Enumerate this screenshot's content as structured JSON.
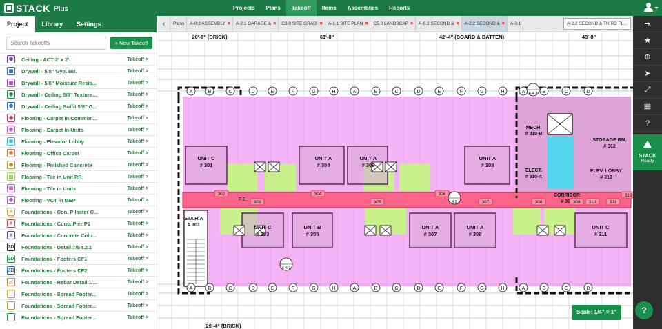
{
  "brand": {
    "name": "STACK",
    "edition": "Plus"
  },
  "nav": [
    "Projects",
    "Plans",
    "Takeoff",
    "Items",
    "Assemblies",
    "Reports"
  ],
  "nav_active": "Takeoff",
  "sidebar": {
    "tabs": [
      "Project",
      "Library",
      "Settings"
    ],
    "active_tab": "Project",
    "search_placeholder": "Search Takeoffs",
    "new_button": "+ New Takeoff",
    "link_label": "Takeoff >",
    "items": [
      {
        "label": "Ceiling - ACT 2' x 2'",
        "icon": "pentagon-icon",
        "glyph": "⬟",
        "color": "#7b3fb6"
      },
      {
        "label": "Drywall - 5/8\" Gyp. Bd.",
        "icon": "grid-icon",
        "glyph": "▦",
        "color": "#2f6bd6"
      },
      {
        "label": "Drywall - 5/8\" Moisture Resis...",
        "icon": "grid-icon",
        "glyph": "▦",
        "color": "#c23fd6"
      },
      {
        "label": "Drywall - Ceiling 5/8\" Texture...",
        "icon": "pentagon-icon",
        "glyph": "⬟",
        "color": "#1f9a4a"
      },
      {
        "label": "Drywall - Ceiling Soffit 5/8\" G...",
        "icon": "pentagon-icon",
        "glyph": "⬟",
        "color": "#2f6bd6"
      },
      {
        "label": "Flooring - Carpet in Common...",
        "icon": "pentagon-icon",
        "glyph": "⬟",
        "color": "#e0335d"
      },
      {
        "label": "Flooring - Carpet in Units",
        "icon": "pentagon-icon",
        "glyph": "⬟",
        "color": "#d64fd1"
      },
      {
        "label": "Flooring - Elevator Lobby",
        "icon": "pentagon-icon",
        "glyph": "⬟",
        "color": "#2fc2e0"
      },
      {
        "label": "Flooring - Office Carpet",
        "icon": "pentagon-icon",
        "glyph": "⬟",
        "color": "#e07a3a"
      },
      {
        "label": "Flooring - Polished Concrete",
        "icon": "pentagon-icon",
        "glyph": "⬟",
        "color": "#c79a2a"
      },
      {
        "label": "Flooring - Tile in Unit RR",
        "icon": "grid-icon",
        "glyph": "▦",
        "color": "#9ad64a"
      },
      {
        "label": "Flooring - Tile in Units",
        "icon": "grid-icon",
        "glyph": "▦",
        "color": "#d64fd1"
      },
      {
        "label": "Flooring - VCT in MEP",
        "icon": "pentagon-icon",
        "glyph": "⬟",
        "color": "#b65ad6"
      },
      {
        "label": "Foundations - Con. Pilaster C...",
        "icon": "cross-icon",
        "glyph": "✕",
        "color": "#e0a32a"
      },
      {
        "label": "Foundations - Conc. Pier P1",
        "icon": "cross-icon",
        "glyph": "✕",
        "color": "#d63a3a"
      },
      {
        "label": "Foundations - Concrete Colu...",
        "icon": "cross-icon",
        "glyph": "✕",
        "color": "#5a3fd6"
      },
      {
        "label": "Foundations - Detail 7/S4.2.1",
        "icon": "3d-icon",
        "glyph": "3D",
        "color": "#333333"
      },
      {
        "label": "Foundations - Footers CF1",
        "icon": "3d-icon",
        "glyph": "3D",
        "color": "#1f9a4a"
      },
      {
        "label": "Foundations - Footers CF2",
        "icon": "3d-icon",
        "glyph": "3D",
        "color": "#2f6bd6"
      },
      {
        "label": "Foundations - Rebar Detail 1/...",
        "icon": "rebar-icon",
        "glyph": "⋰",
        "color": "#e07a3a"
      },
      {
        "label": "Foundations - Spread Footer...",
        "icon": "square-icon",
        "glyph": "",
        "color": "#e0a32a"
      },
      {
        "label": "Foundations - Spread Footer...",
        "icon": "square-icon",
        "glyph": "",
        "color": "#c79a2a"
      },
      {
        "label": "Foundations - Spread Footer...",
        "icon": "square-icon",
        "glyph": "",
        "color": "#1f9a4a"
      }
    ]
  },
  "sheet_tabs": [
    {
      "label": "Plans",
      "closable": false,
      "active": false
    },
    {
      "label": "A-0.3 ASSEMBLY",
      "closable": true,
      "active": false
    },
    {
      "label": "A-2.1 GARAGE &",
      "closable": true,
      "active": false
    },
    {
      "label": "C3.0 SITE GRADI",
      "closable": true,
      "active": false
    },
    {
      "label": "A-1.1 SITE PLAN",
      "closable": true,
      "active": false
    },
    {
      "label": "C5.0 LANDSCAP",
      "closable": true,
      "active": false
    },
    {
      "label": "A-6.2 SECOND &",
      "closable": true,
      "active": false
    },
    {
      "label": "A-2.2 SECOND &",
      "closable": true,
      "active": true
    },
    {
      "label": "A-3.1",
      "closable": false,
      "active": false
    }
  ],
  "sheet_select": "A-2.2 SECOND & THIRD FL...",
  "plan": {
    "dims_top": [
      "20'-8\" (BRICK)",
      "61'-8\"",
      "42'-4\" (BOARD & BATTEN)",
      "48'-8\""
    ],
    "dim_bottom": "29'-4\" (BRICK)",
    "units": [
      {
        "name": "UNIT C",
        "num": "# 301"
      },
      {
        "name": "UNIT A",
        "num": "# 304"
      },
      {
        "name": "UNIT A",
        "num": "# 306"
      },
      {
        "name": "UNIT A",
        "num": "# 308"
      },
      {
        "name": "UNIT C",
        "num": "# 303"
      },
      {
        "name": "UNIT B",
        "num": "# 305"
      },
      {
        "name": "UNIT A",
        "num": "# 307"
      },
      {
        "name": "UNIT A",
        "num": "# 309"
      },
      {
        "name": "UNIT C",
        "num": "# 311"
      }
    ],
    "rooms": [
      {
        "name": "MECH.",
        "num": "# 310-B"
      },
      {
        "name": "ELECT.",
        "num": "# 310-A"
      },
      {
        "name": "STORAGE RM.",
        "num": "# 312"
      },
      {
        "name": "ELEV. LOBBY",
        "num": "# 313"
      },
      {
        "name": "CORRIDOR",
        "num": "# 300"
      },
      {
        "name": "STAIR A",
        "num": "# 301"
      }
    ],
    "tags": [
      "302",
      "303",
      "304",
      "305",
      "306",
      "307",
      "308",
      "309",
      "310",
      "311",
      "312"
    ],
    "fe_label": "F.E.",
    "section_tags": [
      "4.2",
      "A-4.3",
      "A-4.2"
    ],
    "column_grid": [
      "A",
      "B",
      "C",
      "D",
      "E",
      "F",
      "G",
      "H"
    ]
  },
  "scale": "Scale: 1/4\" = 1\"",
  "right_toolbar": [
    "sign-in-icon",
    "star-icon",
    "zoom-icon",
    "pointer-icon",
    "expand-icon",
    "pdf-icon",
    "help-circle-icon"
  ],
  "right_glyphs": [
    "⇥",
    "★",
    "⊕",
    "➤",
    "⤢",
    "▤",
    "?"
  ],
  "stack_ready": {
    "logo": "STACK",
    "state": "Ready"
  },
  "help_glyph": "?"
}
